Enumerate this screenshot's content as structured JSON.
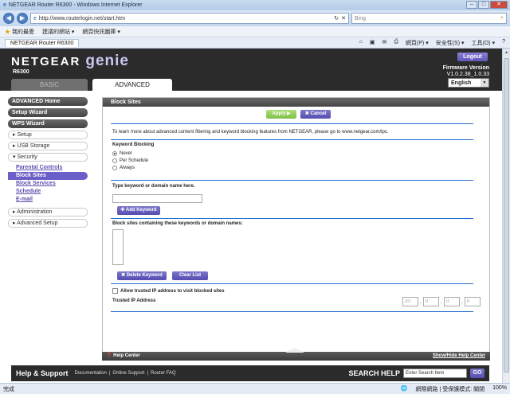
{
  "browser": {
    "title": "NETGEAR Router R6300 - Windows Internet Explorer",
    "address": "http://www.routerlogin.net/start.htm",
    "search_placeholder": "Bing",
    "favorites": "我的最愛",
    "fav_links": [
      "建議的網站 ▾",
      "網頁快訊圖庫 ▾"
    ],
    "tab_title": "NETGEAR Router R6300",
    "tools": [
      "網頁(P) ▾",
      "安全性(S) ▾",
      "工具(O) ▾"
    ],
    "status_left": "完成",
    "status_zone": "網際網路 | 受保護模式: 關閉",
    "zoom": "100%"
  },
  "header": {
    "brand": "NETGEAR",
    "product": "genie",
    "model": "R6300",
    "logout": "Logout",
    "fw_label": "Firmware Version",
    "fw_version": "V1.0.2.38_1.0.33",
    "language": "English",
    "tab_basic": "BASIC",
    "tab_advanced": "ADVANCED"
  },
  "sidebar": {
    "advanced_home": "ADVANCED Home",
    "setup_wizard": "Setup Wizard",
    "wps_wizard": "WPS Wizard",
    "setup": "▸ Setup",
    "usb_storage": "▸ USB Storage",
    "security": "▾ Security",
    "security_items": [
      "Parental Controls",
      "Block Sites",
      "Block Services",
      "Schedule",
      "E-mail"
    ],
    "administration": "▸ Administration",
    "advanced_setup": "▸ Advanced Setup"
  },
  "main": {
    "title": "Block Sites",
    "apply": "Apply ▶",
    "cancel": "✖ Cancel",
    "intro": "To learn more about advanced content filtering and keyword blocking features from NETGEAR, please go to www.netgear.com/lpc.",
    "kw_heading": "Keyword Blocking",
    "opt_never": "Never",
    "opt_schedule": "Per Schedule",
    "opt_always": "Always",
    "type_label": "Type keyword or domain name here.",
    "add_keyword": "✚ Add Keyword",
    "block_list_label": "Block sites containing these keywords or domain names:",
    "delete_keyword": "✖ Delete Keyword",
    "clear_list": "Clear List",
    "allow_trusted": "Allow trusted IP address to visit blocked sites",
    "trusted_ip": "Trusted IP Address",
    "ip_values": [
      "10",
      "0",
      "0",
      "0"
    ]
  },
  "helpbar": {
    "help_center": "❓ Help Center",
    "show_hide": "Show/Hide Help Center"
  },
  "footer": {
    "help_support": "Help & Support",
    "links": [
      "Documentation",
      "|",
      "Online Support",
      "|",
      "Router FAQ"
    ],
    "search_help": "SEARCH HELP",
    "search_placeholder": "Enter Search Item",
    "go": "GO"
  }
}
